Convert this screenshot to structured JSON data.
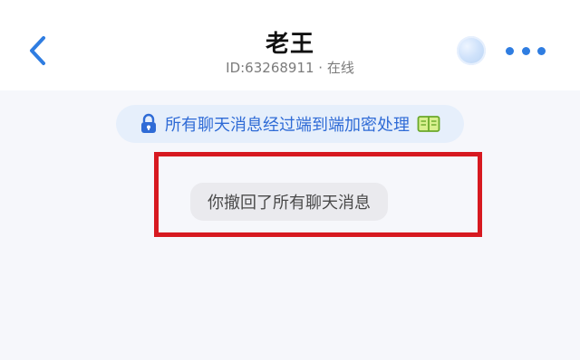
{
  "header": {
    "title": "老王",
    "subtitle": "ID:63268911 · 在线",
    "back_icon": "chevron-left-icon",
    "more_icon": "more-dots-icon"
  },
  "notice": {
    "text": "所有聊天消息经过端到端加密处理",
    "lock_icon": "lock-icon",
    "book_icon": "book-icon"
  },
  "system_message": {
    "text": "你撤回了所有聊天消息"
  },
  "colors": {
    "accent": "#2f7de1",
    "notice_bg": "#e6effb",
    "highlight": "#d71920",
    "bubble_bg": "#eaeaee"
  }
}
